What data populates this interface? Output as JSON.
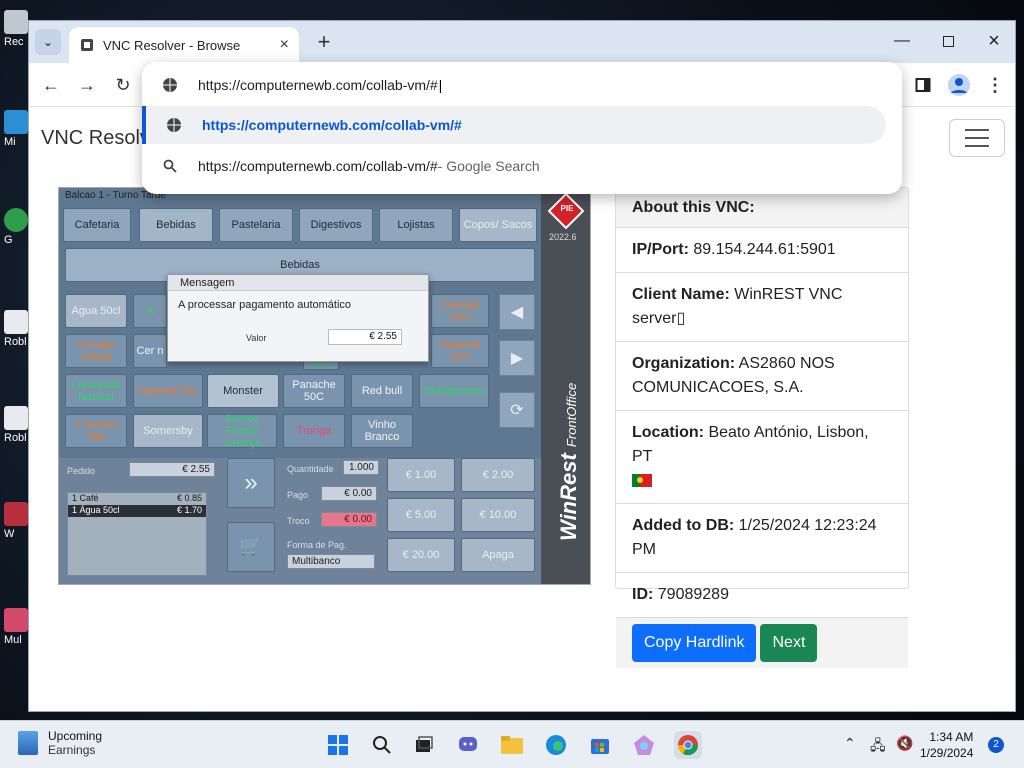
{
  "desktop": {
    "icons": [
      "Rec",
      "Mi",
      "G",
      "Robl",
      "Robl",
      "W",
      "Mul"
    ]
  },
  "browser": {
    "tab_title": "VNC Resolver - Browse",
    "address_value": "https://computernewb.com/collab-vm/#",
    "suggestion_url": "https://computernewb.com/collab-vm/#",
    "search_query": "https://computernewb.com/collab-vm/#",
    "search_suffix": " - Google Search"
  },
  "page": {
    "brand": "VNC Resolv",
    "vnc_screen": {
      "header": "Balcao 1 - Turno Tarde",
      "categories": [
        "Cafetaria",
        "Bebidas",
        "Pastelaria",
        "Digestivos",
        "Lojistas",
        "Copos/ Sacos"
      ],
      "selected_category": "Bebidas",
      "products": [
        "Agua 50cl",
        "A",
        "Cerveja 33cl",
        "Cerveja media",
        "Cer n",
        "Imperial 20cl",
        "Sumo",
        "Laranjada Natural",
        "Imperial 30c",
        "Monster",
        "Panache 50C",
        "Red bull",
        "Refrigerante",
        "7 Sumos Nat",
        "Somersby",
        "Sumos Frutos Laranja",
        "Tronga",
        "Vinho Branco"
      ],
      "modal_title": "Mensagem",
      "modal_text": "A processar pagamento automático",
      "modal_label": "Valor",
      "modal_value": "€ 2.55",
      "pedido_label": "Pedido",
      "pedido_value": "€ 2.55",
      "ticket": [
        {
          "item": "1 Café",
          "price": "€ 0.85"
        },
        {
          "item": "1 Água 50cl",
          "price": "€ 1.70"
        }
      ],
      "quantidade_label": "Quantidade",
      "quantidade_value": "1.000",
      "pago_label": "Pago",
      "pago_value": "€ 0.00",
      "troco_label": "Troco",
      "troco_value": "€ 0.00",
      "forma_label": "Forma de Pag.",
      "forma_value": "Multibanco",
      "cash_buttons": [
        "€ 1.00",
        "€ 2.00",
        "€ 5.00",
        "€ 10.00",
        "€ 20.00",
        "Apaga"
      ],
      "brand_version": "2022.6",
      "brand_pie": "PIE",
      "brand_name": "WinRest",
      "brand_suffix": "FrontOffice"
    },
    "card": {
      "header": "About this VNC:",
      "ip_label": "IP/Port:",
      "ip_value": "89.154.244.61:5901",
      "client_label": "Client Name:",
      "client_value": "WinREST VNC server▯",
      "org_label": "Organization:",
      "org_value": "AS2860 NOS COMUNICACOES, S.A.",
      "location_label": "Location:",
      "location_value": "Beato António, Lisbon, PT",
      "added_label": "Added to DB:",
      "added_value": "1/25/2024 12:23:24 PM",
      "id_label": "ID:",
      "id_value": "79089289",
      "copy_button": "Copy Hardlink",
      "next_button": "Next"
    }
  },
  "taskbar": {
    "widget_title": "Upcoming",
    "widget_sub": "Earnings",
    "time": "1:34 AM",
    "date": "1/29/2024",
    "notification_count": "2"
  },
  "colors": {
    "primary": "#0d6efd",
    "success": "#198754",
    "omnibox_link": "#0b57d0"
  }
}
